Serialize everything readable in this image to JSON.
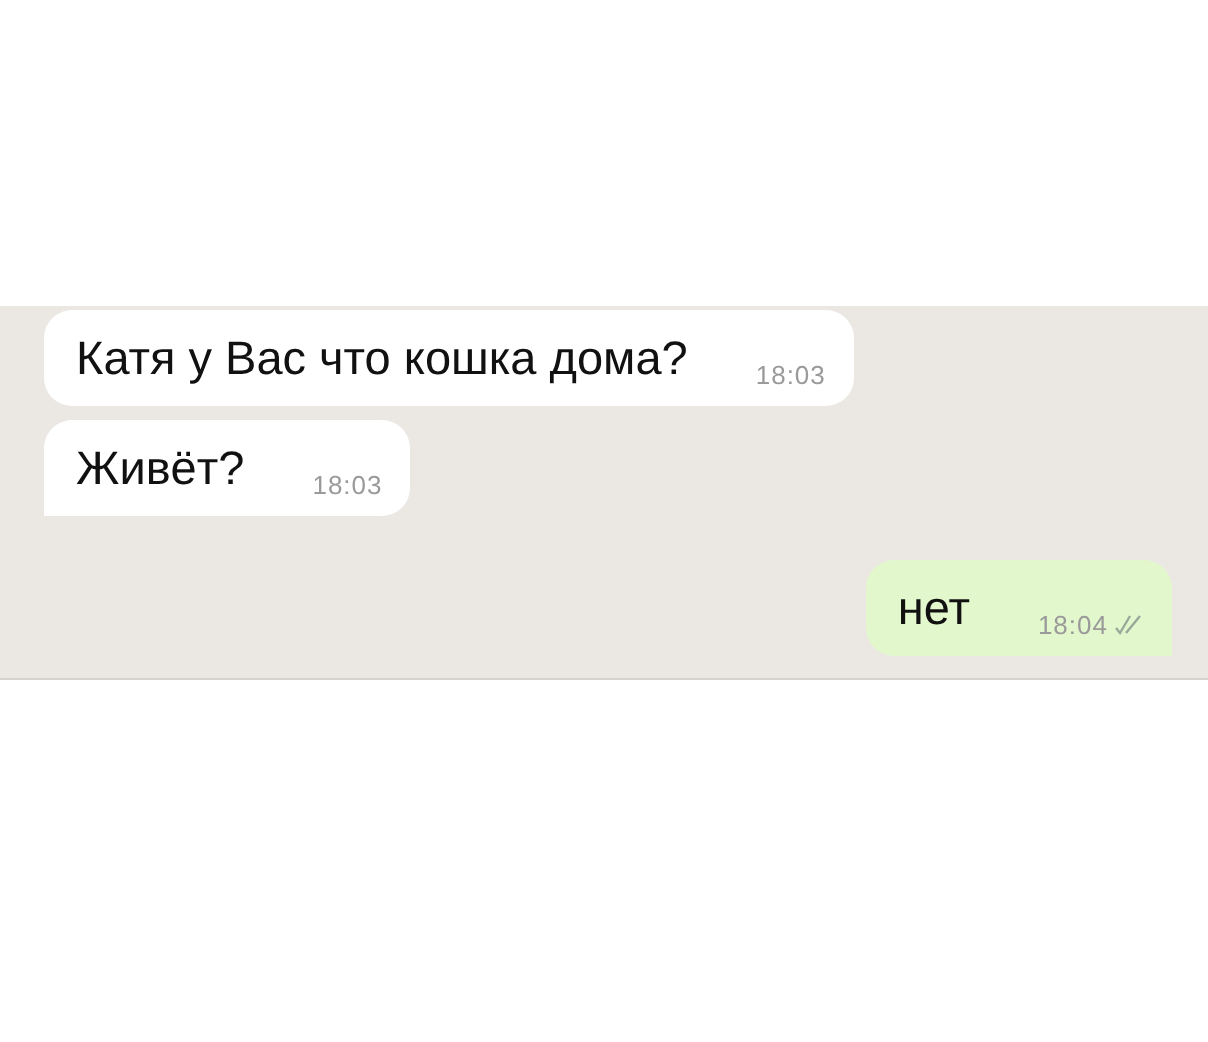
{
  "messages": [
    {
      "text": "Катя у Вас что кошка дома?",
      "time": "18:03",
      "outgoing": false,
      "tail": false
    },
    {
      "text": "Живёт?",
      "time": "18:03",
      "outgoing": false,
      "tail": true
    },
    {
      "text": "нет",
      "time": "18:04",
      "outgoing": true,
      "tail": true,
      "double_check": true
    }
  ]
}
